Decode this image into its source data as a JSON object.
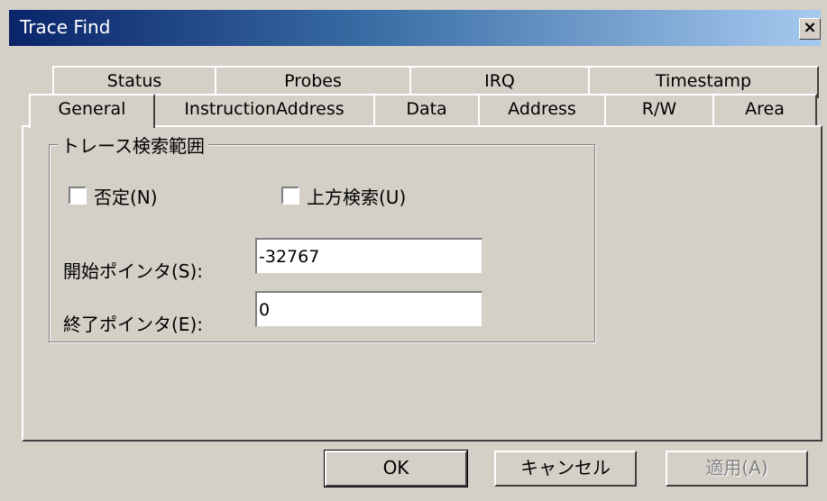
{
  "window": {
    "title": "Trace Find",
    "close_label": "×"
  },
  "tabs": {
    "row1": [
      "Status",
      "Probes",
      "IRQ",
      "Timestamp"
    ],
    "row2": [
      "General",
      "InstructionAddress",
      "Data",
      "Address",
      "R/W",
      "Area"
    ],
    "active": "General"
  },
  "group": {
    "title": "トレース検索範囲",
    "negate_label": "否定(N)",
    "negate_checked": false,
    "search_up_label": "上方検索(U)",
    "search_up_checked": false,
    "start_label": "開始ポインタ(S):",
    "start_value": "-32767",
    "end_label": "終了ポインタ(E):",
    "end_value": "0"
  },
  "buttons": {
    "ok": "OK",
    "cancel": "キャンセル",
    "apply": "適用(A)"
  }
}
